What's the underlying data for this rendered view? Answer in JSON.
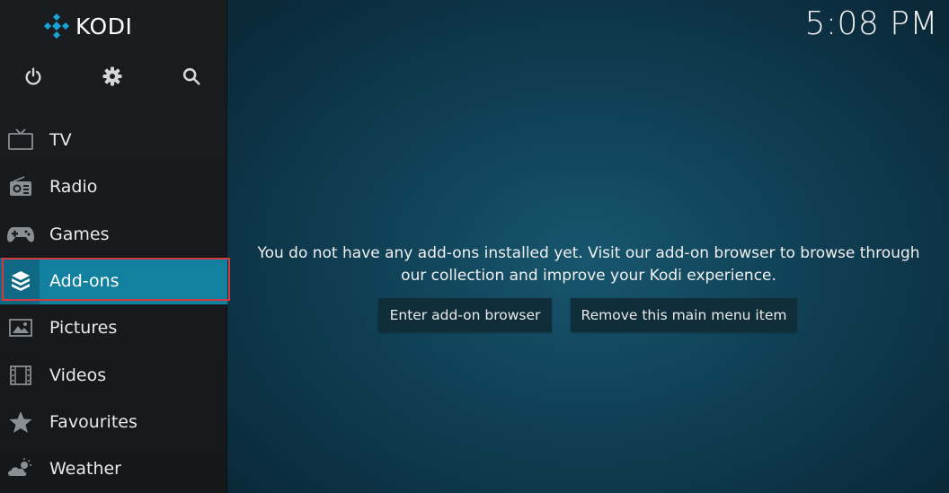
{
  "app": {
    "logo_text": "KODI",
    "clock": "5:08 PM"
  },
  "top_icons": [
    {
      "name": "power-icon"
    },
    {
      "name": "settings-icon"
    },
    {
      "name": "search-icon"
    }
  ],
  "menu": {
    "items": [
      {
        "label": "TV",
        "icon": "tv-icon"
      },
      {
        "label": "Radio",
        "icon": "radio-icon"
      },
      {
        "label": "Games",
        "icon": "gamepad-icon"
      },
      {
        "label": "Add-ons",
        "icon": "addon-box-icon",
        "active": true
      },
      {
        "label": "Pictures",
        "icon": "picture-icon"
      },
      {
        "label": "Videos",
        "icon": "film-icon"
      },
      {
        "label": "Favourites",
        "icon": "star-icon"
      },
      {
        "label": "Weather",
        "icon": "weather-icon"
      }
    ]
  },
  "main": {
    "message": "You do not have any add-ons installed yet. Visit our add-on browser to browse through our collection and improve your Kodi experience.",
    "buttons": {
      "enter_browser": "Enter add-on browser",
      "remove_item": "Remove this main menu item"
    }
  },
  "colors": {
    "accent": "#12809f",
    "highlight_border": "#d43b41",
    "sidebar_bg": "#1a1d20",
    "main_bg": "#104156"
  }
}
